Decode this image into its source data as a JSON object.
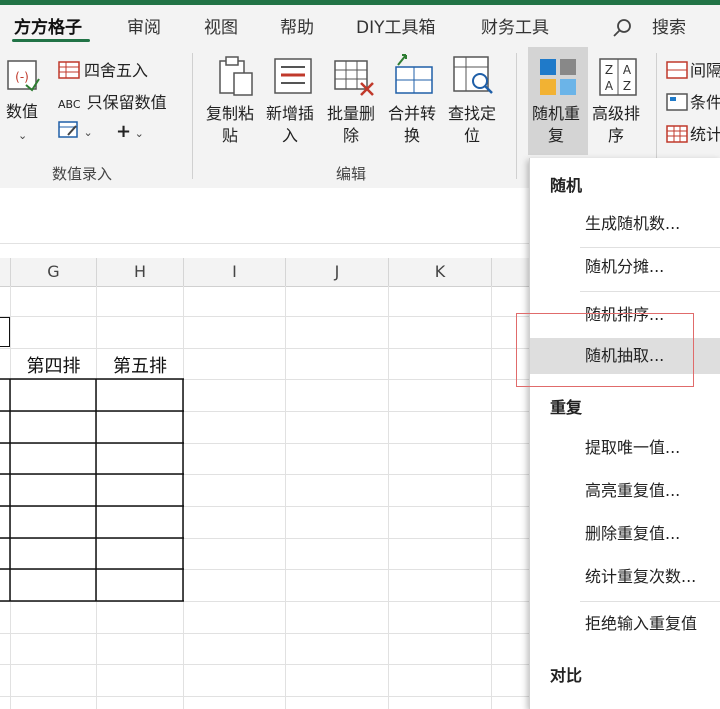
{
  "tabs": [
    {
      "label": "方方格子",
      "active": true
    },
    {
      "label": "审阅"
    },
    {
      "label": "视图"
    },
    {
      "label": "帮助"
    },
    {
      "label": "DIY工具箱"
    },
    {
      "label": "财务工具"
    },
    {
      "label": "搜索"
    }
  ],
  "ribbon": {
    "numeric_entry": {
      "value_button": "数值",
      "round_button": "四舍五入",
      "keep_value_button": "只保留数值",
      "abc_glyph": "ABC",
      "plus_glyph": "+",
      "group_label": "数值录入"
    },
    "edit": {
      "copy_paste": "复制粘\n贴",
      "new_insert": "新增插\n入",
      "batch_delete": "批量删\n除",
      "merge_convert": "合并转\n换",
      "find_locate": "查找定\n位",
      "group_label": "编辑"
    },
    "random_repeat": "随机重\n复",
    "advanced_sort": "高级排\n序",
    "interval": "间隔",
    "condition": "条件",
    "stats": "统计",
    "sort_letters": {
      "z1": "Z",
      "a1": "A",
      "a2": "A",
      "z2": "Z"
    }
  },
  "columns": [
    "G",
    "H",
    "I",
    "J",
    "K"
  ],
  "cells": {
    "g_header": "第四排",
    "h_header": "第五排"
  },
  "menu": {
    "section_random": "随机",
    "items_random": [
      "生成随机数...",
      "随机分摊...",
      "随机排序...",
      "随机抽取..."
    ],
    "section_repeat": "重复",
    "items_repeat": [
      "提取唯一值...",
      "高亮重复值...",
      "删除重复值...",
      "统计重复次数...",
      "拒绝输入重复值"
    ],
    "section_compare": "对比",
    "highlighted": "随机抽取..."
  },
  "colors": {
    "excel_green": "#217346",
    "highlight_box": "#e06b6b"
  }
}
